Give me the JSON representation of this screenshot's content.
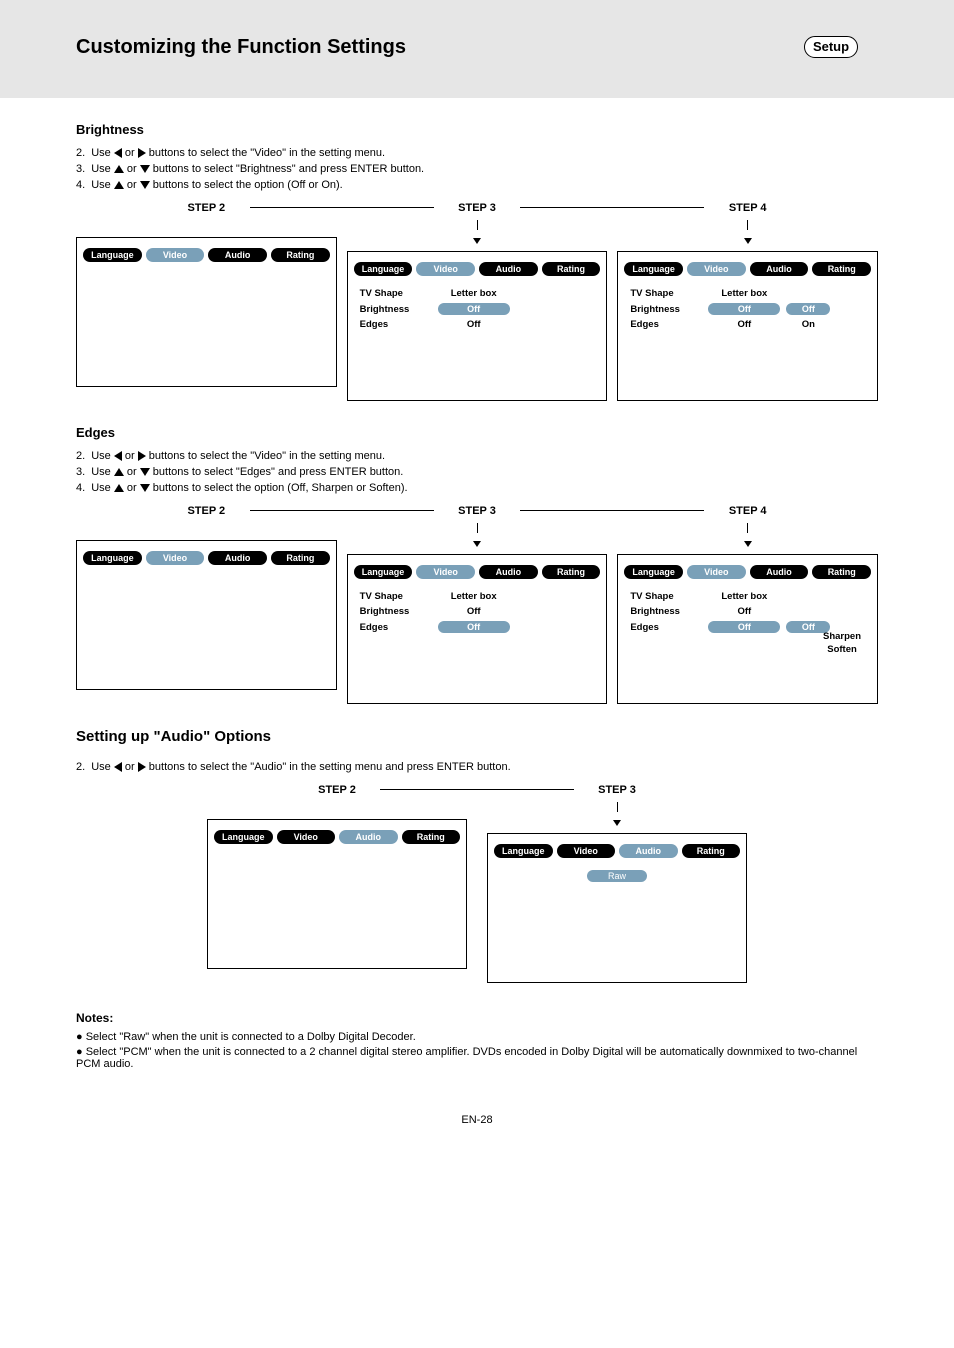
{
  "page": {
    "title": "Customizing the Function Settings",
    "badge": "Setup",
    "footer": "EN-28"
  },
  "tabs": {
    "language": "Language",
    "video": "Video",
    "audio": "Audio",
    "rating": "Rating"
  },
  "video_rows": {
    "tvshape": "TV Shape",
    "brightness": "Brightness",
    "edges": "Edges",
    "letterbox": "Letter box",
    "off": "Off",
    "on": "On",
    "sharpen": "Sharpen",
    "soften": "Soften"
  },
  "audio_row": {
    "raw": "Raw"
  },
  "steps": {
    "s2": "STEP 2",
    "s3": "STEP 3",
    "s4": "STEP 4"
  },
  "brightness": {
    "title": "Brightness",
    "b1_a": "Use ",
    "b1_b": " or ",
    "b1_c": " buttons to select the \"Video\" in the setting menu.",
    "b2_a": "Use ",
    "b2_b": " or ",
    "b2_c": " buttons to select \"Brightness\" and press ENTER button.",
    "b3_a": "Use ",
    "b3_b": " or ",
    "b3_c": " buttons to select the option (Off or On)."
  },
  "edges": {
    "title": "Edges",
    "b1_a": "Use ",
    "b1_b": " or ",
    "b1_c": " buttons to select the \"Video\" in the setting menu.",
    "b2_a": "Use ",
    "b2_b": " or ",
    "b2_c": " buttons to select \"Edges\" and press ENTER button.",
    "b3_a": "Use ",
    "b3_b": " or ",
    "b3_c": " buttons to select the option (Off, Sharpen or Soften)."
  },
  "audio": {
    "title": "Setting up \"Audio\" Options",
    "b2_a": "Use ",
    "b2_b": " or ",
    "b2_c": " buttons to select the \"Audio\" in the setting menu and press ENTER button."
  },
  "notes": {
    "title": "Notes:",
    "n1": "Select \"Raw\" when the unit is connected to a Dolby Digital Decoder.",
    "n2": "Select \"PCM\" when the unit is connected to a 2 channel digital stereo amplifier. DVDs encoded in Dolby Digital will be automatically downmixed to two-channel PCM audio."
  }
}
